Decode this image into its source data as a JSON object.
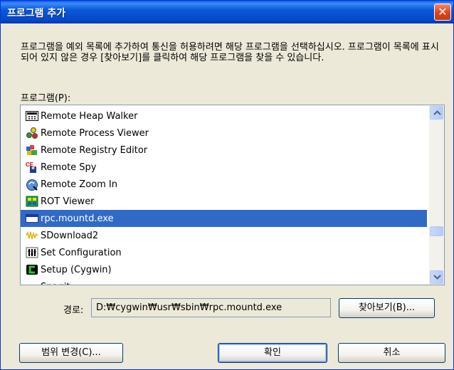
{
  "window": {
    "title": "프로그램 추가",
    "close_symbol": "✕"
  },
  "description": "프로그램을 예외 목록에 추가하여 통신을 허용하려면 해당 프로그램을 선택하십시오. 프로그램이 목록에 표시되어 있지 않은 경우 [찾아보기]를 클릭하여 해당 프로그램을 찾을 수 있습니다.",
  "program_list": {
    "label": "프로그램(P):",
    "items": [
      {
        "label": "Remote Heap Walker",
        "icon": "heap-walker-icon"
      },
      {
        "label": "Remote Process Viewer",
        "icon": "process-viewer-icon"
      },
      {
        "label": "Remote Registry Editor",
        "icon": "registry-editor-icon"
      },
      {
        "label": "Remote Spy",
        "icon": "spy-icon"
      },
      {
        "label": "Remote Zoom In",
        "icon": "zoom-icon"
      },
      {
        "label": "ROT Viewer",
        "icon": "rot-viewer-icon"
      },
      {
        "label": "rpc.mountd.exe",
        "icon": "executable-icon",
        "selected": true
      },
      {
        "label": "SDownload2",
        "icon": "waveform-icon"
      },
      {
        "label": "Set Configuration",
        "icon": "configuration-icon"
      },
      {
        "label": "Setup (Cygwin)",
        "icon": "cygwin-icon"
      },
      {
        "label": "Snagit",
        "icon": "snagit-icon"
      }
    ],
    "selected_index": 6
  },
  "path": {
    "label": "경로:",
    "value": "D:₩cygwin₩usr₩sbin₩rpc.mountd.exe"
  },
  "buttons": {
    "browse": "찾아보기(B)...",
    "change_scope": "범위 변경(C)...",
    "ok": "확인",
    "cancel": "취소"
  },
  "colors": {
    "title_bar": "#0A58D8",
    "selection": "#316AC5",
    "dialog_bg": "#ECE9D8"
  }
}
